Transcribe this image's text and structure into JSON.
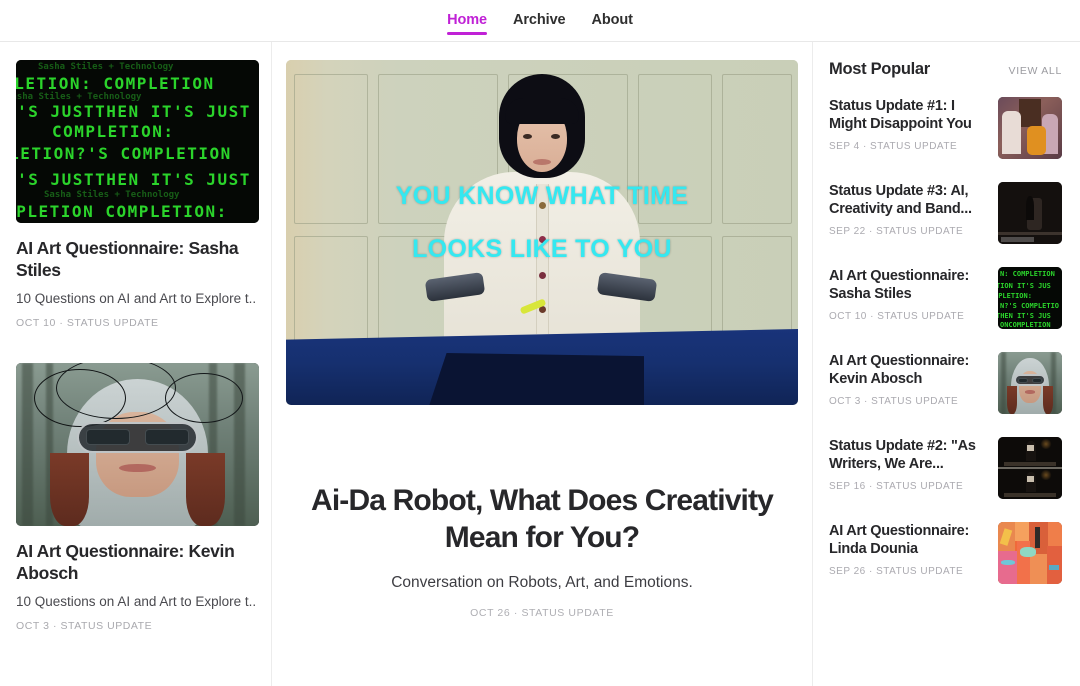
{
  "header": {
    "nav": [
      {
        "label": "Home",
        "active": true
      },
      {
        "label": "Archive",
        "active": false
      },
      {
        "label": "About",
        "active": false
      }
    ],
    "active_color": "#c021d6"
  },
  "left_column": {
    "cards": [
      {
        "title": "AI Art Questionnaire: Sasha Stiles",
        "subtitle": "10 Questions on AI and Art to Explore t...",
        "meta": "OCT 10 · STATUS UPDATE",
        "thumb_name": "terminal-green-code-art",
        "thumb_lines": [
          "Sasha Stiles + Technology",
          "MPLETION:  COMPLETION",
          "Sasha Stiles + Technology",
          "T'S JUST THEN IT'S JUST",
          "COMPLETION:",
          "PLETION?'S  COMPLETION",
          "T'S JUST THEN IT'S JUST",
          "Sasha Stiles + Technology",
          "OMPLETION COMPLETION:"
        ]
      },
      {
        "title": "AI Art Questionnaire: Kevin Abosch",
        "subtitle": "10 Questions on AI and Art to Explore t...",
        "meta": "OCT 3 · STATUS UPDATE",
        "thumb_name": "cyborg-forest-portrait"
      }
    ]
  },
  "main": {
    "hero": {
      "image_name": "ai-da-robot-video-still",
      "caption_line1": "YOU KNOW WHAT TIME",
      "caption_line2": "LOOKS LIKE TO YOU",
      "caption_color": "#35e8f0"
    },
    "title": "Ai-Da Robot, What Does Creativity Mean for You?",
    "subtitle": "Conversation on Robots, Art, and Emotions.",
    "meta": "OCT 26 · STATUS UPDATE"
  },
  "sidebar": {
    "title": "Most Popular",
    "view_all": "VIEW ALL",
    "items": [
      {
        "title": "Status Update #1: I Might Disappoint You",
        "meta": "SEP 4 · STATUS UPDATE",
        "thumb_name": "classroom-photo"
      },
      {
        "title": "Status Update #3: AI, Creativity and Band...",
        "meta": "SEP 22 · STATUS UPDATE",
        "thumb_name": "lecture-photo"
      },
      {
        "title": "AI Art Questionnaire: Sasha Stiles",
        "meta": "OCT 10 · STATUS UPDATE",
        "thumb_name": "terminal-green-code-art"
      },
      {
        "title": "AI Art Questionnaire: Kevin Abosch",
        "meta": "OCT 3 · STATUS UPDATE",
        "thumb_name": "cyborg-forest-portrait"
      },
      {
        "title": "Status Update #2: \"As Writers, We Are...",
        "meta": "SEP 16 · STATUS UPDATE",
        "thumb_name": "stage-talk-photo"
      },
      {
        "title": "AI Art Questionnaire: Linda Dounia",
        "meta": "SEP 26 · STATUS UPDATE",
        "thumb_name": "orange-abstract-collage"
      }
    ]
  }
}
